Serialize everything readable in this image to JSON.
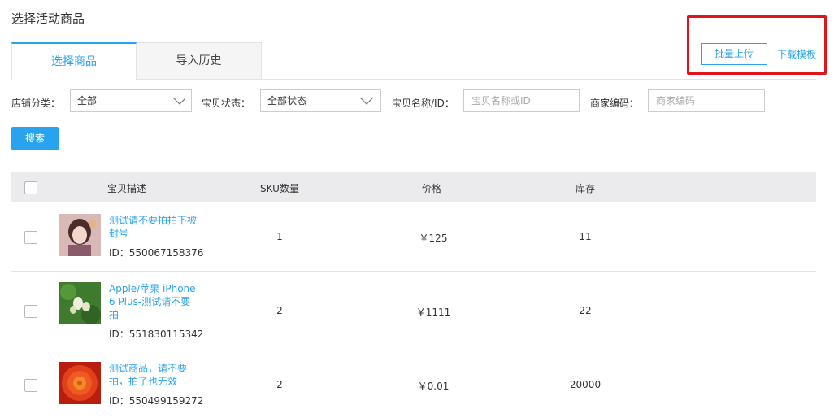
{
  "page": {
    "title": "选择活动商品"
  },
  "tabs": [
    {
      "label": "选择商品"
    },
    {
      "label": "导入历史"
    }
  ],
  "actions": {
    "batch_upload": "批量上传",
    "download_template": "下载模板"
  },
  "filters": {
    "shop_category_label": "店铺分类：",
    "shop_category_value": "全部",
    "item_status_label": "宝贝状态：",
    "item_status_value": "全部状态",
    "item_name_label": "宝贝名称/ID：",
    "item_name_placeholder": "宝贝名称或ID",
    "merchant_code_label": "商家编码：",
    "merchant_code_placeholder": "商家编码"
  },
  "search_button": "搜索",
  "table": {
    "headers": {
      "description": "宝贝描述",
      "sku": "SKU数量",
      "price": "价格",
      "stock": "库存"
    },
    "rows": [
      {
        "title": "测试请不要拍拍下被封号",
        "id": "ID：550067158376",
        "sku": "1",
        "price": "￥125",
        "stock": "11",
        "thumb": "portrait-thumbnail"
      },
      {
        "title": "Apple/苹果 iPhone 6 Plus-测试请不要拍",
        "id": "ID：551830115342",
        "sku": "2",
        "price": "￥1111",
        "stock": "22",
        "thumb": "flower-bud-thumbnail"
      },
      {
        "title": "测试商品，请不要拍，拍了也无效",
        "id": "ID：550499159272",
        "sku": "2",
        "price": "￥0.01",
        "stock": "20000",
        "thumb": "red-flower-thumbnail"
      }
    ]
  },
  "colors": {
    "accent": "#2aa3ef",
    "highlight": "#e0151b",
    "header_bg": "#ebebee"
  }
}
